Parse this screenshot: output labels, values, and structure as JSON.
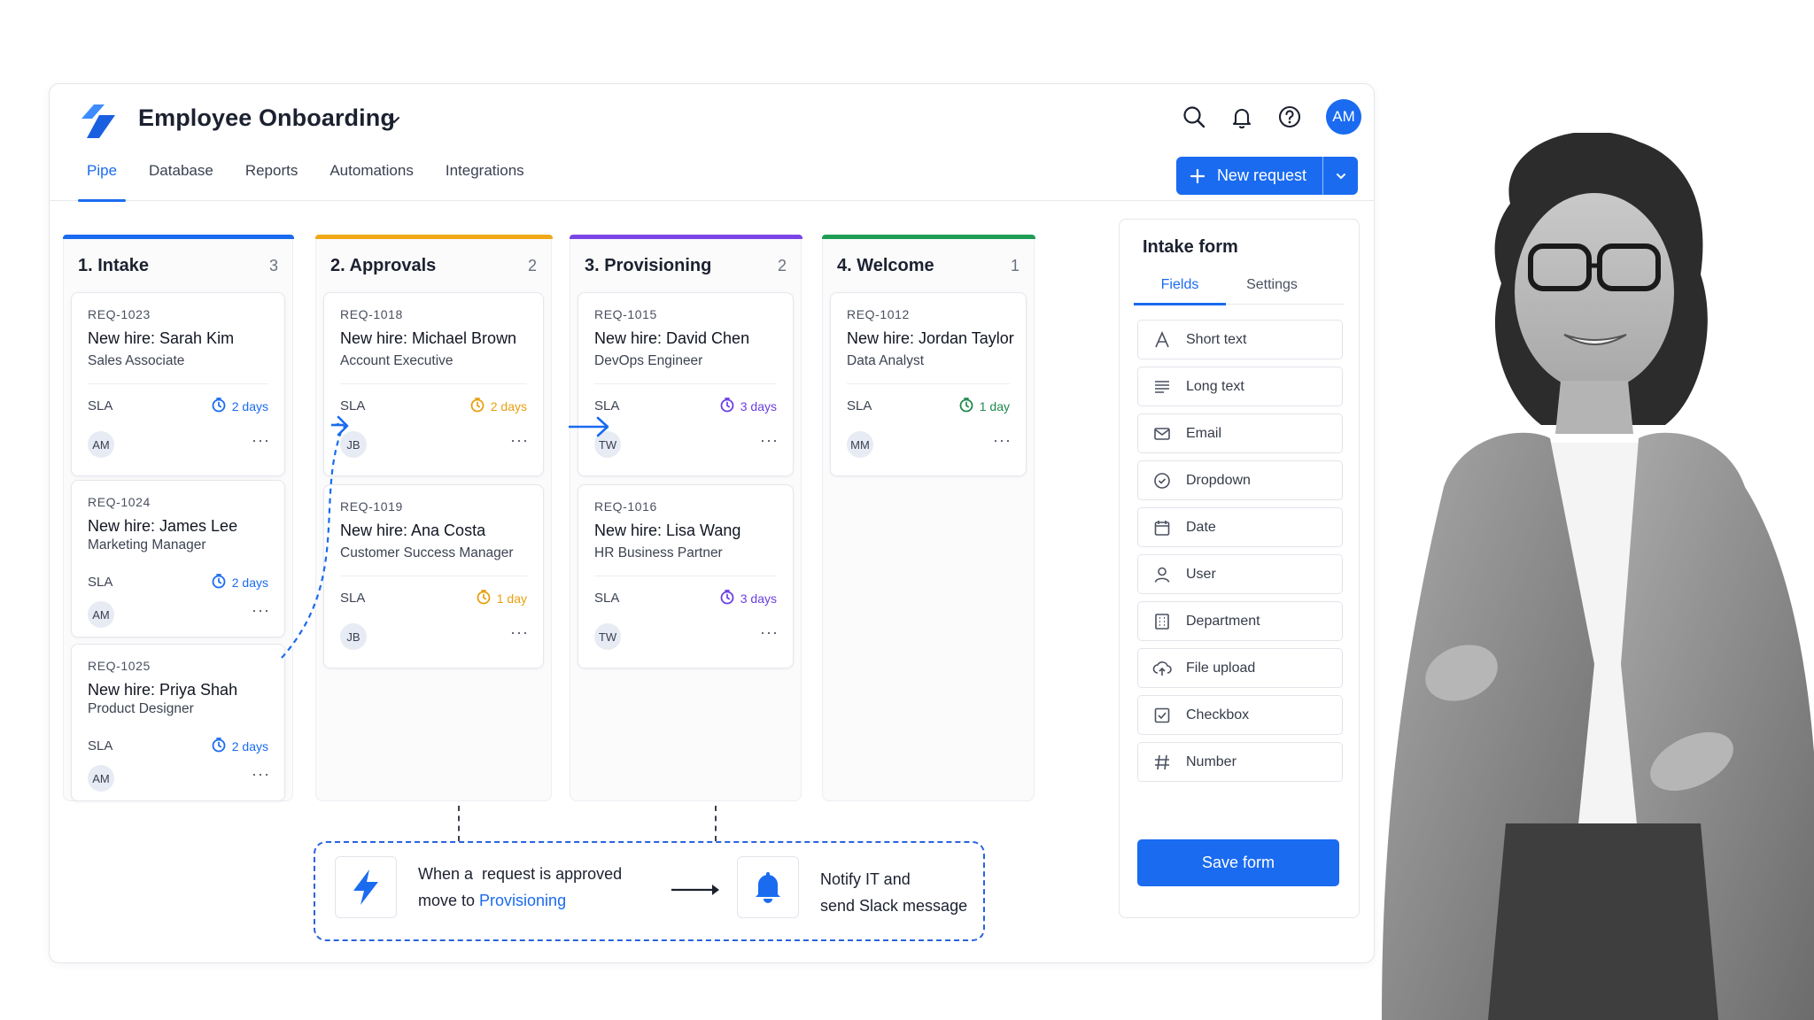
{
  "app": {
    "title": "Employee Onboarding",
    "user_initials": "AM",
    "accent_color": "#1a6bf0"
  },
  "tabs": [
    {
      "label": "Pipe",
      "active": true
    },
    {
      "label": "Database",
      "active": false
    },
    {
      "label": "Reports",
      "active": false
    },
    {
      "label": "Automations",
      "active": false
    },
    {
      "label": "Integrations",
      "active": false
    }
  ],
  "actions": {
    "new_request_label": "New request"
  },
  "columns": [
    {
      "title": "1. Intake",
      "count": "3",
      "color": "#1a6bf0",
      "cards": [
        {
          "id": "REQ-1023",
          "name": "New hire: Sarah Kim",
          "role": "Sales Associate",
          "sla_label": "SLA",
          "due": "2 days",
          "due_color": "#1a6bf0",
          "assignee": "AM"
        },
        {
          "id": "REQ-1024",
          "name": "New hire: James Lee",
          "role": "Marketing Manager",
          "sla_label": "SLA",
          "due": "2 days",
          "due_color": "#1a6bf0",
          "assignee": "AM"
        },
        {
          "id": "REQ-1025",
          "name": "New hire: Priya Shah",
          "role": "Product Designer",
          "sla_label": "SLA",
          "due": "2 days",
          "due_color": "#1a6bf0",
          "assignee": "AM"
        }
      ]
    },
    {
      "title": "2. Approvals",
      "count": "2",
      "color": "#f0a818",
      "cards": [
        {
          "id": "REQ-1018",
          "name": "New hire: Michael Brown",
          "role": "Account Executive",
          "sla_label": "SLA",
          "due": "2 days",
          "due_color": "#e8a010",
          "assignee": "JB"
        },
        {
          "id": "REQ-1019",
          "name": "New hire: Ana Costa",
          "role": "Customer Success Manager",
          "sla_label": "SLA",
          "due": "1 day",
          "due_color": "#e8a010",
          "assignee": "JB"
        }
      ]
    },
    {
      "title": "3. Provisioning",
      "count": "2",
      "color": "#7b45e6",
      "cards": [
        {
          "id": "REQ-1015",
          "name": "New hire: David Chen",
          "role": "DevOps Engineer",
          "sla_label": "SLA",
          "due": "3 days",
          "due_color": "#6b3fe0",
          "assignee": "TW"
        },
        {
          "id": "REQ-1016",
          "name": "New hire: Lisa Wang",
          "role": "HR Business Partner",
          "sla_label": "SLA",
          "due": "3 days",
          "due_color": "#6b3fe0",
          "assignee": "TW"
        }
      ]
    },
    {
      "title": "4. Welcome",
      "count": "1",
      "color": "#1f9d55",
      "cards": [
        {
          "id": "REQ-1012",
          "name": "New hire: Jordan Taylor",
          "role": "Data Analyst",
          "sla_label": "SLA",
          "due": "1 day",
          "due_color": "#1f8a4c",
          "assignee": "MM"
        }
      ]
    }
  ],
  "intake_form": {
    "title": "Intake form",
    "tabs": [
      {
        "label": "Fields",
        "active": true
      },
      {
        "label": "Settings",
        "active": false
      }
    ],
    "fields": [
      {
        "label": "Short text",
        "icon": "letter-a-icon"
      },
      {
        "label": "Long text",
        "icon": "lines-icon"
      },
      {
        "label": "Email",
        "icon": "envelope-icon"
      },
      {
        "label": "Dropdown",
        "icon": "circle-check-icon"
      },
      {
        "label": "Date",
        "icon": "calendar-icon"
      },
      {
        "label": "User",
        "icon": "user-icon"
      },
      {
        "label": "Department",
        "icon": "building-icon"
      },
      {
        "label": "File upload",
        "icon": "cloud-upload-icon"
      },
      {
        "label": "Checkbox",
        "icon": "checkbox-icon"
      },
      {
        "label": "Number",
        "icon": "hash-icon"
      }
    ],
    "save_label": "Save form"
  },
  "automation": {
    "trigger_line1": "When a  request is approved",
    "trigger_line2_prefix": "move to ",
    "trigger_target": "Provisioning",
    "action_line1": "Notify IT and",
    "action_line2": "send Slack message"
  }
}
